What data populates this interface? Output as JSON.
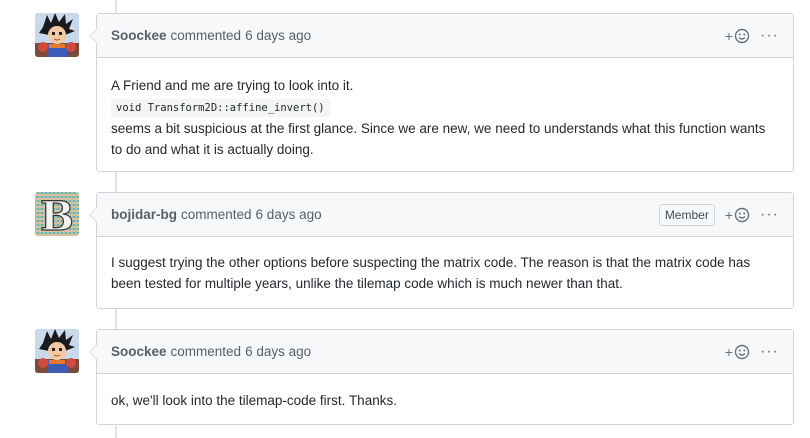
{
  "comments": [
    {
      "author": "Soockee",
      "action": "commented",
      "time": "6 days ago",
      "badge": "",
      "paragraphs": [
        "A Friend and me are trying to look into it.",
        "seems a bit suspicious at the first glance. Since we are new, we need to understands what this function wants to do and what it is actually doing."
      ],
      "code": "void Transform2D::affine_invert()",
      "avatar_icon": "goku-avatar-icon"
    },
    {
      "author": "bojidar-bg",
      "action": "commented",
      "time": "6 days ago",
      "badge": "Member",
      "paragraphs": [
        "I suggest trying the other options before suspecting the matrix code. The reason is that the matrix code has been tested for multiple years, unlike the tilemap code which is much newer than that."
      ],
      "avatar_icon": "letter-b-avatar-icon"
    },
    {
      "author": "Soockee",
      "action": "commented",
      "time": "6 days ago",
      "badge": "",
      "paragraphs": [
        "ok, we'll look into the tilemap-code first. Thanks."
      ],
      "avatar_icon": "goku-avatar-icon"
    }
  ],
  "actions": {
    "reaction_plus": "+",
    "more": "···"
  },
  "colors": {
    "header_bg": "#f6f8fa",
    "border": "#d1d5da",
    "muted_text": "#586069"
  }
}
